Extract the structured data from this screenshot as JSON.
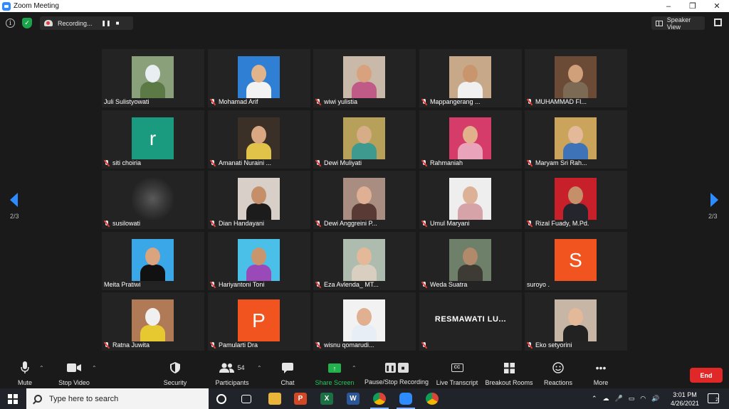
{
  "window": {
    "title": "Zoom Meeting",
    "minimize": "–",
    "maximize": "❐",
    "close": "✕"
  },
  "topbar": {
    "recording_label": "Recording...",
    "pause_symbol": "❚❚",
    "stop_symbol": "■",
    "speaker_view_label": "Speaker View"
  },
  "pagination": {
    "left": "2/3",
    "right": "2/3"
  },
  "participants": [
    {
      "name": "Juli Sulistyowati",
      "muted": false,
      "kind": "photo",
      "bg": "#8aa07a",
      "skin": "#e8eef2",
      "cloth": "#5c7a46"
    },
    {
      "name": "Mohamad Arif",
      "muted": true,
      "kind": "photo",
      "bg": "#2f7fd4",
      "skin": "#e2b48c",
      "cloth": "#f2f2f2"
    },
    {
      "name": "wiwi yulistia",
      "muted": true,
      "kind": "photo",
      "bg": "#c9b9a8",
      "skin": "#d9a27e",
      "cloth": "#c05a86"
    },
    {
      "name": "Mappangerang ...",
      "muted": true,
      "kind": "photo",
      "bg": "#c7a98a",
      "skin": "#c8956c",
      "cloth": "#f0f0f0"
    },
    {
      "name": "MUHAMMAD FI...",
      "muted": true,
      "kind": "photo",
      "bg": "#6b4a36",
      "skin": "#d0a07a",
      "cloth": "#7d6a55"
    },
    {
      "name": "siti choiria",
      "muted": true,
      "kind": "letter",
      "letter": "r",
      "bg": "#1a9a7f"
    },
    {
      "name": "Amanati Nuraini ...",
      "muted": true,
      "kind": "photo",
      "bg": "#3a3028",
      "skin": "#d9a882",
      "cloth": "#e2c34a"
    },
    {
      "name": "Dewi Muliyati",
      "muted": true,
      "kind": "photo",
      "bg": "#b6a05a",
      "skin": "#d7ad88",
      "cloth": "#3e9a8e"
    },
    {
      "name": "Rahmaniah",
      "muted": true,
      "kind": "photo",
      "bg": "#d63c6a",
      "skin": "#e3b08c",
      "cloth": "#e9a4bb"
    },
    {
      "name": "Maryam Sri Rah...",
      "muted": true,
      "kind": "photo",
      "bg": "#caa45a",
      "skin": "#e3b99a",
      "cloth": "#3f73b8"
    },
    {
      "name": "susilowati",
      "muted": true,
      "kind": "blur",
      "bg": "#2c2c2c"
    },
    {
      "name": "Dian Handayani",
      "muted": true,
      "kind": "photo",
      "bg": "#d8d0c8",
      "skin": "#c58f6a",
      "cloth": "#1c1c1c"
    },
    {
      "name": "Dewi Anggreini P...",
      "muted": true,
      "kind": "photo",
      "bg": "#a88d80",
      "skin": "#e0b095",
      "cloth": "#5a3a34"
    },
    {
      "name": "Umul Maryani",
      "muted": true,
      "kind": "photo",
      "bg": "#eeeeee",
      "skin": "#dcb195",
      "cloth": "#d6a3a8"
    },
    {
      "name": "Rizal Fuady, M.Pd.",
      "muted": true,
      "kind": "photo",
      "bg": "#c8202a",
      "skin": "#c58f6a",
      "cloth": "#25252e"
    },
    {
      "name": "Meita Pratiwi",
      "muted": false,
      "kind": "photo",
      "bg": "#3aa7e8",
      "skin": "#d9a47e",
      "cloth": "#111111"
    },
    {
      "name": "Hariyantoni Toni",
      "muted": true,
      "kind": "photo",
      "bg": "#4ac0e8",
      "skin": "#c8956c",
      "cloth": "#9a4ab8"
    },
    {
      "name": "Eza Avlenda_ MT...",
      "muted": true,
      "kind": "photo",
      "bg": "#aebcb0",
      "skin": "#e3b99a",
      "cloth": "#d8cfc0"
    },
    {
      "name": "Weda Suatra",
      "muted": true,
      "kind": "photo",
      "bg": "#6e7f6a",
      "skin": "#b08a6a",
      "cloth": "#3e3a34"
    },
    {
      "name": "suroyo .",
      "muted": false,
      "kind": "letter",
      "letter": "S",
      "bg": "#f1541f"
    },
    {
      "name": "Ratna Juwita",
      "muted": true,
      "kind": "photo",
      "bg": "#b07a56",
      "skin": "#f0f0f0",
      "cloth": "#e6c830"
    },
    {
      "name": "Pamularti Dra",
      "muted": true,
      "kind": "letter",
      "letter": "P",
      "bg": "#f1541f"
    },
    {
      "name": "wisnu qomarudi...",
      "muted": true,
      "kind": "photo",
      "bg": "#f2f2f2",
      "skin": "#e0b090",
      "cloth": "#e8eef5"
    },
    {
      "name": "",
      "muted": true,
      "kind": "nameonly",
      "display": "RESMAWATI LU..."
    },
    {
      "name": "Eko setyorini",
      "muted": true,
      "kind": "photo",
      "bg": "#c7b5a6",
      "skin": "#e3b99a",
      "cloth": "#222222"
    }
  ],
  "toolbar": {
    "mute": "Mute",
    "stop_video": "Stop Video",
    "security": "Security",
    "participants": "Participants",
    "participants_count": "54",
    "chat": "Chat",
    "share_screen": "Share Screen",
    "pause_stop_recording": "Pause/Stop Recording",
    "live_transcript": "Live Transcript",
    "cc": "CC",
    "breakout_rooms": "Breakout Rooms",
    "reactions": "Reactions",
    "more": "More",
    "end": "End"
  },
  "taskbar": {
    "search_placeholder": "Type here to search",
    "time": "3:01 PM",
    "date": "4/26/2021",
    "notifications": "2"
  }
}
